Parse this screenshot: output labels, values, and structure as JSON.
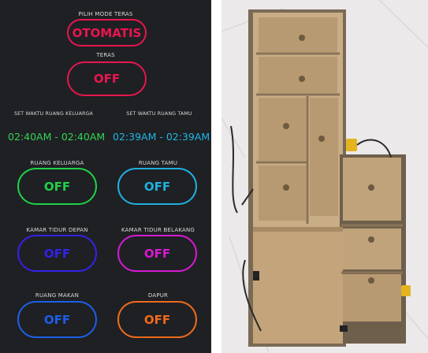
{
  "app": {
    "mode_label": "PILIH MODE TERAS",
    "mode_value": "OTOMATIS",
    "teras_label": "TERAS",
    "teras_value": "OFF",
    "time_keluarga_label": "SET WAKTU RUANG KELUARGA",
    "time_tamu_label": "SET WAKTU RUANG TAMU",
    "time_keluarga_value": "02:40AM - 02:40AM",
    "time_tamu_value": "02:39AM - 02:39AM",
    "rooms": [
      {
        "label": "RUANG KELUARGA",
        "value": "OFF",
        "color": "#1fd14a"
      },
      {
        "label": "RUANG TAMU",
        "value": "OFF",
        "color": "#1fb0e0"
      },
      {
        "label": "KAMAR TIDUR DEPAN",
        "value": "OFF",
        "color": "#3322e6"
      },
      {
        "label": "KAMAR TIDUR BELAKANG",
        "value": "OFF",
        "color": "#d51ad3"
      },
      {
        "label": "RUANG MAKAN",
        "value": "OFF",
        "color": "#1c5fe8"
      },
      {
        "label": "DAPUR",
        "value": "OFF",
        "color": "#ef6a1d"
      }
    ]
  },
  "colors": {
    "mode_accent": "#e8164f",
    "time_keluarga": "#33d456",
    "time_tamu": "#1fb6e6",
    "background": "#1f2023"
  }
}
